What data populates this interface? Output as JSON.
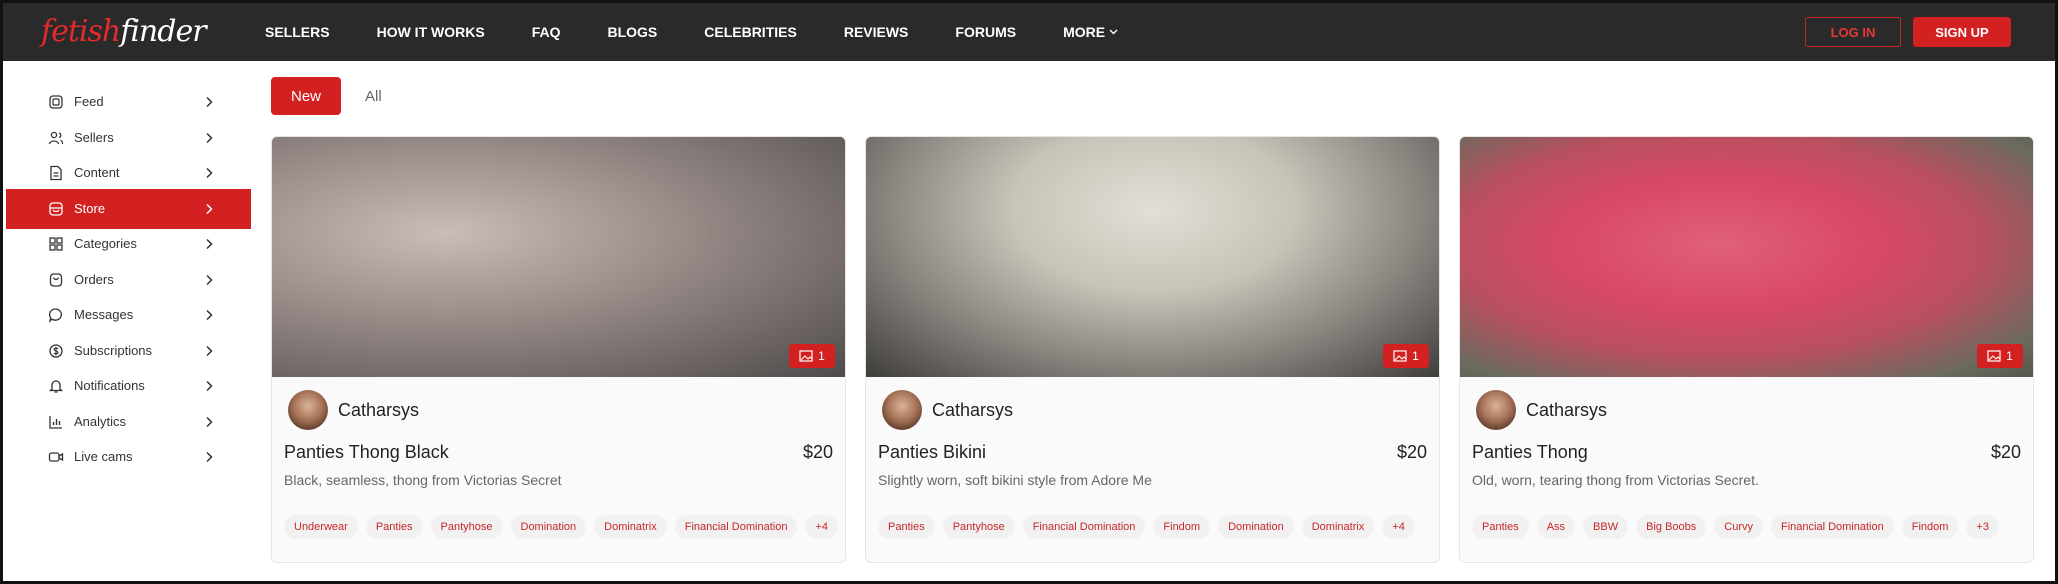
{
  "brand": {
    "part1": "fetish",
    "part2": "finder"
  },
  "nav": {
    "items": [
      "SELLERS",
      "HOW IT WORKS",
      "FAQ",
      "BLOGS",
      "CELEBRITIES",
      "REVIEWS",
      "FORUMS",
      "MORE"
    ],
    "login": "LOG IN",
    "signup": "SIGN UP"
  },
  "sidebar": {
    "items": [
      {
        "label": "Feed",
        "icon": "feed-icon"
      },
      {
        "label": "Sellers",
        "icon": "users-icon"
      },
      {
        "label": "Content",
        "icon": "document-icon"
      },
      {
        "label": "Store",
        "icon": "store-icon",
        "active": true
      },
      {
        "label": "Categories",
        "icon": "grid-icon"
      },
      {
        "label": "Orders",
        "icon": "bag-icon"
      },
      {
        "label": "Messages",
        "icon": "chat-icon"
      },
      {
        "label": "Subscriptions",
        "icon": "dollar-icon"
      },
      {
        "label": "Notifications",
        "icon": "bell-icon"
      },
      {
        "label": "Analytics",
        "icon": "chart-icon"
      },
      {
        "label": "Live cams",
        "icon": "camera-icon"
      }
    ]
  },
  "tabs": {
    "new": "New",
    "all": "All"
  },
  "cards": [
    {
      "seller": "Catharsys",
      "title": "Panties Thong Black",
      "price": "$20",
      "description": "Black, seamless, thong from Victorias Secret",
      "image_count": "1",
      "tags": [
        "Underwear",
        "Panties",
        "Pantyhose",
        "Domination",
        "Dominatrix",
        "Financial Domination",
        "+4"
      ]
    },
    {
      "seller": "Catharsys",
      "title": "Panties Bikini",
      "price": "$20",
      "description": "Slightly worn, soft bikini style from Adore Me",
      "image_count": "1",
      "tags": [
        "Panties",
        "Pantyhose",
        "Financial Domination",
        "Findom",
        "Domination",
        "Dominatrix",
        "+4"
      ]
    },
    {
      "seller": "Catharsys",
      "title": "Panties Thong",
      "price": "$20",
      "description": "Old, worn, tearing thong from Victorias Secret.",
      "image_count": "1",
      "tags": [
        "Panties",
        "Ass",
        "BBW",
        "Big Boobs",
        "Curvy",
        "Financial Domination",
        "Findom",
        "+3"
      ]
    }
  ],
  "colors": {
    "accent": "#d32020",
    "topbar": "#2a2a2a"
  }
}
